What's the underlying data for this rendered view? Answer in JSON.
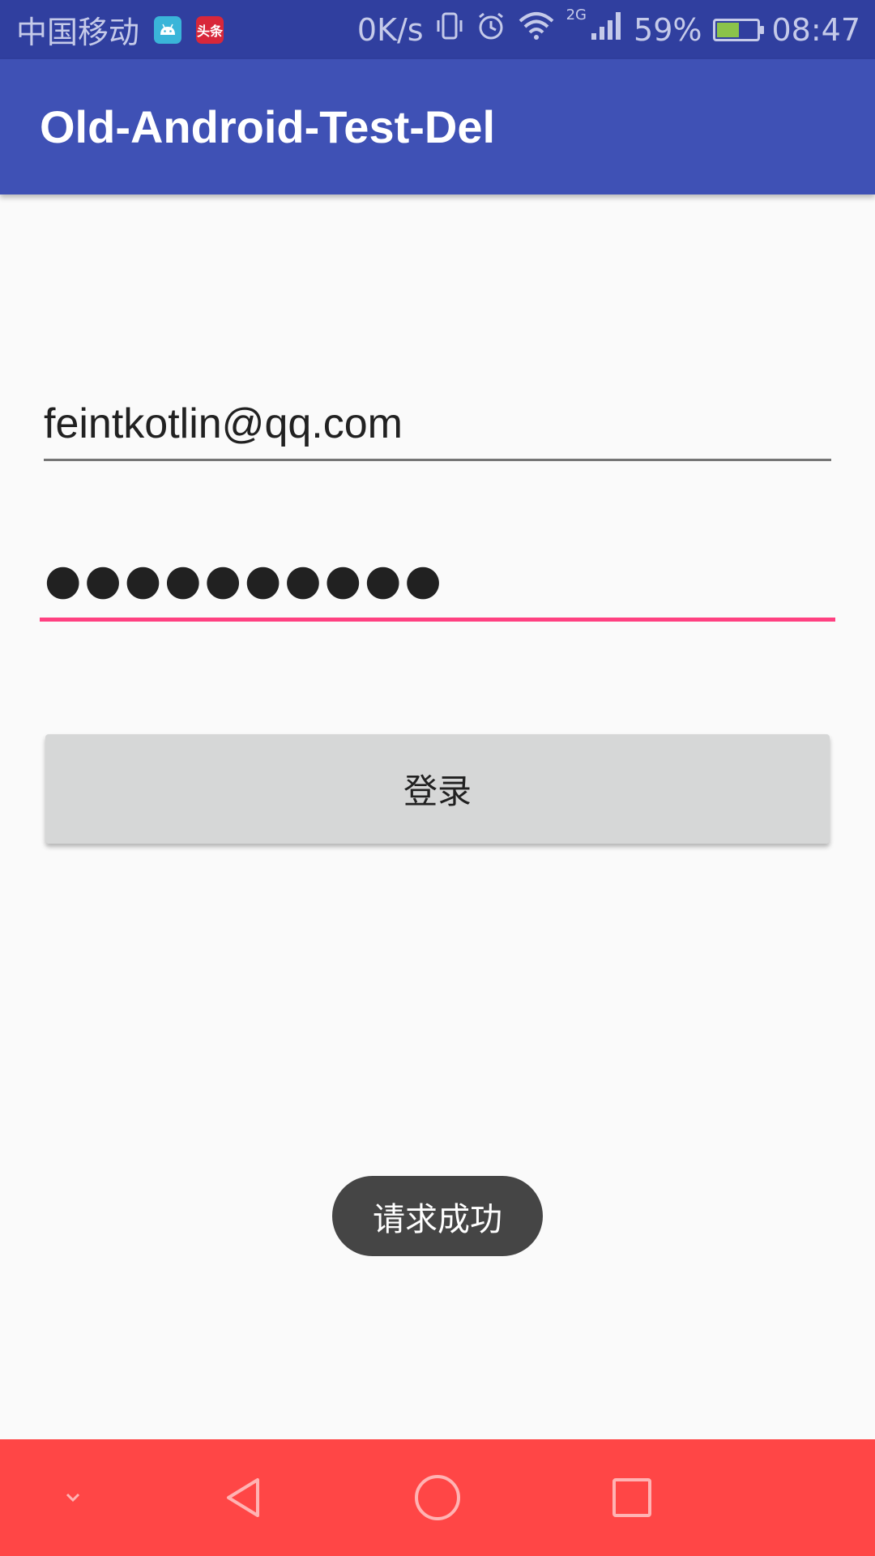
{
  "status_bar": {
    "carrier": "中国移动",
    "app_icons": [
      "android-icon",
      "toutiao-icon"
    ],
    "toutiao_label": "头条",
    "network_speed": "0K/s",
    "network_type": "2G",
    "battery_percent": "59%",
    "battery_level": 0.59,
    "time": "08:47"
  },
  "app_bar": {
    "title": "Old-Android-Test-Del"
  },
  "form": {
    "email_value": "feintkotlin@qq.com",
    "password_value": "●●●●●●●●●●",
    "login_label": "登录"
  },
  "toast": {
    "message": "请求成功"
  },
  "nav_bar": {
    "icons": [
      "chevron-down-icon",
      "back-icon",
      "home-icon",
      "recents-icon"
    ]
  },
  "colors": {
    "status_bar": "#303f9f",
    "primary": "#3f51b5",
    "accent": "#ff4081",
    "nav_bar": "#ff4646",
    "button": "#d6d7d7",
    "toast": "#454545"
  }
}
